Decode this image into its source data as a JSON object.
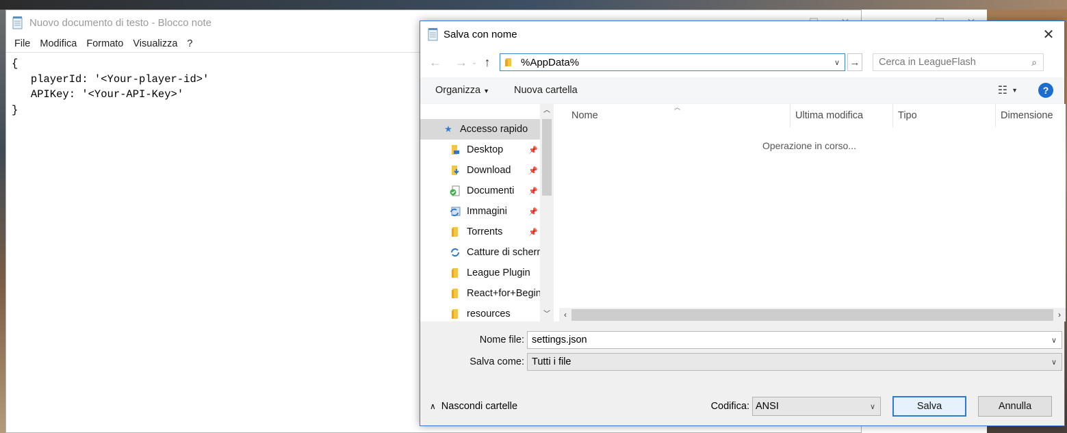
{
  "notepad": {
    "title": "Nuovo documento di testo - Blocco note",
    "menu": [
      "File",
      "Modifica",
      "Formato",
      "Visualizza",
      "?"
    ],
    "editor_text": "{\n   playerId: '<Your-player-id>'\n   APIKey: '<Your-API-Key>'\n}"
  },
  "dialog": {
    "title": "Salva con nome",
    "address": "%AppData%",
    "search_placeholder": "Cerca in LeagueFlash",
    "toolbar": {
      "organize": "Organizza",
      "new_folder": "Nuova cartella"
    },
    "nav": {
      "header": "Accesso rapido",
      "items": [
        {
          "label": "Desktop",
          "pinned": true,
          "icon": "desktop-folder-icon"
        },
        {
          "label": "Download",
          "pinned": true,
          "icon": "download-folder-icon"
        },
        {
          "label": "Documenti",
          "pinned": true,
          "icon": "documents-folder-icon"
        },
        {
          "label": "Immagini",
          "pinned": true,
          "icon": "pictures-folder-icon"
        },
        {
          "label": "Torrents",
          "pinned": true,
          "icon": "folder-icon"
        },
        {
          "label": "Catture di scherm",
          "pinned": false,
          "icon": "sync-folder-icon"
        },
        {
          "label": "League Plugin",
          "pinned": false,
          "icon": "folder-icon"
        },
        {
          "label": "React+for+Begin",
          "pinned": false,
          "icon": "folder-icon"
        },
        {
          "label": "resources",
          "pinned": false,
          "icon": "folder-icon"
        }
      ]
    },
    "columns": [
      "Nome",
      "Ultima modifica",
      "Tipo",
      "Dimensione"
    ],
    "status": "Operazione in corso...",
    "filename_label": "Nome file:",
    "filename_value": "settings.json",
    "savetype_label": "Salva come:",
    "savetype_value": "Tutti i file",
    "hide_folders": "Nascondi cartelle",
    "encoding_label": "Codifica:",
    "encoding_value": "ANSI",
    "save_button": "Salva",
    "cancel_button": "Annulla",
    "help_label": "?"
  },
  "colors": {
    "accent": "#2f78d4",
    "folder": "#f4c542",
    "help": "#1c6dd2"
  }
}
